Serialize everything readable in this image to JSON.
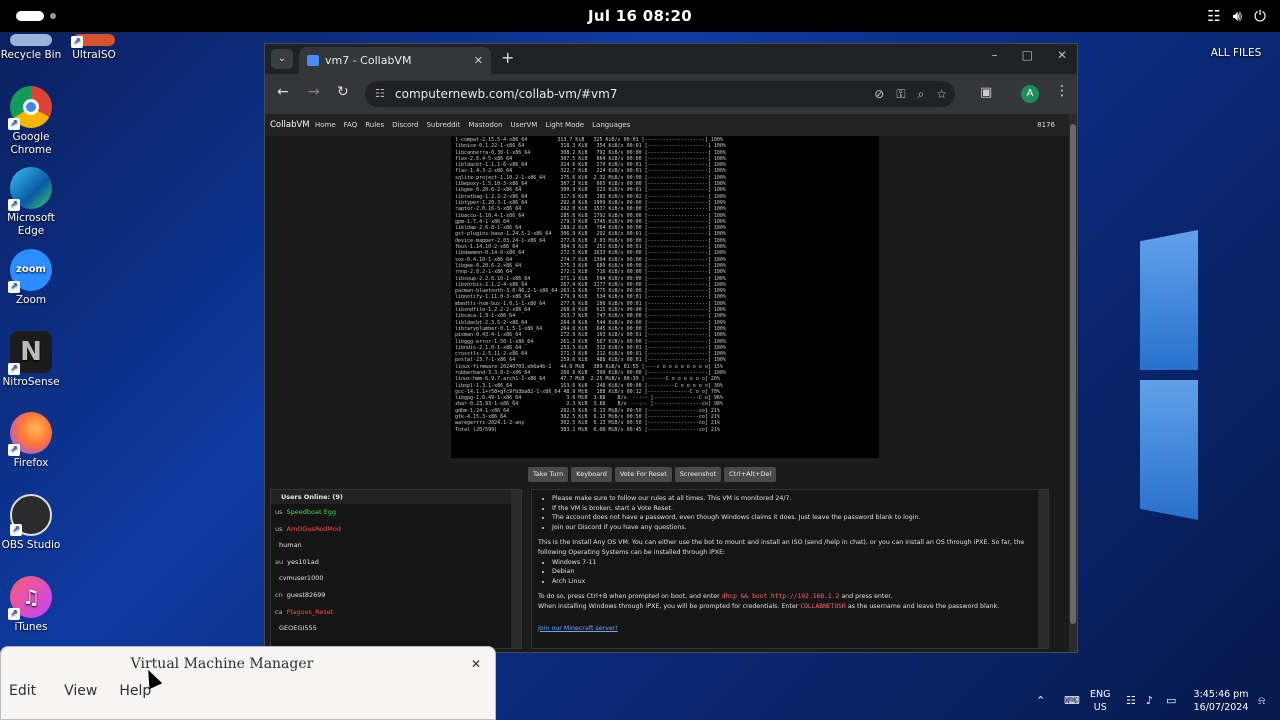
{
  "topbar": {
    "datetime": "Jul 16  08:20"
  },
  "desktop": {
    "icons": [
      {
        "label": "Recycle Bin",
        "icon": "recycle-bin-icon"
      },
      {
        "label": "UltraISO",
        "icon": "ultraiso-icon"
      },
      {
        "label": "Google Chrome",
        "icon": "chrome-icon"
      },
      {
        "label": "Microsoft Edge",
        "icon": "edge-icon"
      },
      {
        "label": "Zoom",
        "icon": "zoom-icon"
      },
      {
        "label": "NitroSense",
        "icon": "nitrosense-icon"
      },
      {
        "label": "Firefox",
        "icon": "firefox-icon"
      },
      {
        "label": "OBS Studio",
        "icon": "obs-icon"
      },
      {
        "label": "iTunes",
        "icon": "itunes-icon"
      }
    ],
    "all_files": "ALL FILES"
  },
  "browser": {
    "tab_title": "vm7 - CollabVM",
    "url": "computernewb.com/collab-vm/#vm7",
    "profile_initial": "A",
    "site_nav": {
      "brand": "CollabVM",
      "items": [
        "Home",
        "FAQ",
        "Rules",
        "Discord",
        "Subreddit",
        "Mastodon",
        "UserVM",
        "Light Mode",
        "Languages"
      ],
      "user_count": "8176"
    },
    "vm_console": "l-compat-2.15.5-4-x86_64          313.7 KiB   325 KiB/s 00:01 [--------------------] 100%\nlibnice-0.1.22-1-x86_64            318.3 KiB   354 KiB/s 00:01 [--------------------] 100%\nlibcanberra-0.30-1-x86_64          308.2 KiB   792 KiB/s 00:00 [--------------------] 100%\nflex-2.6.4-5-x86_64                307.5 KiB   664 KiB/s 00:00 [--------------------] 100%\nlibldacbt-1.1.1-6-x86_64           314.6 KiB   270 KiB/s 00:01 [--------------------] 100%\nflac-1.4.3-2-x86_64                322.7 KiB   224 KiB/s 00:01 [--------------------] 100%\nsqlite-project-1.10.2-1-x86_64     275.6 KiB  2.32 MiB/s 00:00 [--------------------] 100%\nlibepoxy-1.5.10-3-x86_64           307.3 KiB   665 KiB/s 00:00 [--------------------] 100%\nlibgee-0.20.6-2-x86_64             300.9 KiB   323 KiB/s 00:01 [--------------------] 100%\nlibratbag-1.2.2-2-x86_64           317.6 KiB   183 KiB/s 00:02 [--------------------] 100%\nlibtyper-1.20.3-1-x86_64           292.0 KiB  1909 KiB/s 00:00 [--------------------] 100%\nraptor-2.0.16-5-x86_64             292.0 KiB  1537 KiB/s 00:00 [--------------------] 100%\nlibaccu-1.10.4-1-x86_64            285.6 KiB  1792 KiB/s 00:00 [--------------------] 100%\ngpm-1.7.4-1-x86_64                 279.3 KiB  1745 KiB/s 00:00 [--------------------] 100%\nlibldap-2.6.8-1-x86_64             289.2 KiB   764 KiB/s 00:00 [--------------------] 100%\ngst-plugins-base-1.24.5-2-x86_64   306.9 KiB   292 KiB/s 00:01 [--------------------] 100%\ndevice-mapper-2.03.24-1-x86_64     277.6 KiB  2.03 MiB/s 00:00 [--------------------] 100%\nfbus-1.14.10-2-x86_64              304.9 KiB   251 KiB/s 00:01 [--------------------] 100%\nlibdaemon-0.14-6-x86_64            272.5 KiB  1633 KiB/s 00:00 [--------------------] 100%\nsox-0.4.10-1-x86_64                274.7 KiB  1304 KiB/s 00:00 [--------------------] 100%\nlibgee-0.20.6-2-x86_64             275.3 KiB   689 KiB/s 00:00 [--------------------] 100%\nrnnp-2.0.2-1-x86_64                272.1 KiB   716 KiB/s 00:00 [--------------------] 100%\nlibsoup-2.2.6.10-1-x86_64          271.1 KiB   594 KiB/s 00:00 [--------------------] 100%\nlibvorbis-2.1.2-4-x86_64           267.4 KiB  1177 KiB/s 00:00 [--------------------] 100%\npacman-bluetooth-3.0.46.2-1-x86_64 263.1 KiB   775 KiB/s 00:00 [--------------------] 100%\nlibnotify-1.11.0-3-x86_64          279.9 KiB   534 KiB/s 00:01 [--------------------] 100%\nmbedtls-hsm-bus-1.0.1-1-x86_64     277.6 KiB   286 KiB/s 00:01 [--------------------] 100%\nlibsndfile-1.2.2-2-x86_64          268.6 KiB   615 KiB/s 00:00 [--------------------] 100%\nlibcaca-1.9-1-x86_64               263.7 KiB   747 KiB/s 00:00 [--------------------] 100%\nlibldacbt-2.3.5-2-x86_64           264.0 KiB   544 KiB/s 00:00 [--------------------] 100%\nlibraryplumber-0.1.5-1-x86_64      264.0 KiB   645 KiB/s 00:00 [--------------------] 100%\npixman-0.43.4-1-x86_64             272.9 KiB   103 KiB/s 00:01 [--------------------] 100%\nlibggg-error-1.50-1-x86_64         261.3 KiB   567 KiB/s 00:00 [--------------------] 100%\nlibndis-2.1.0-1-x86_64             253.5 KiB   312 KiB/s 00:01 [--------------------] 100%\ncrosstls-2.5.11-2-x86_64           271.3 KiB   212 KiB/s 00:01 [--------------------] 100%\npostal-23.7-1-x86_64               259.6 KiB   488 KiB/s 00:01 [--------------------] 100%\nlinux-firmware-20240703.eb6a4b-1   44.0 MiB   389 KiB/s 01:55 [----c o o o o o o o o] 15%\nrubberband-3.3.0-2-x86_64          260.6 KiB   390 KiB/s 00:00 [--------------------] 100%\nlinux-hmm-6.9.7.arch1-1-x86_64     47.7 MiB  2.25 MiB/s 00:39 [-------C o o o o o o] 20%\nlibxpl-1.3.1-x86_64                153.6 KiB   248 KiB/s 00:00 [---------C o o o o o] 30%\ngcc-14.1.1+r58+gfc9fb3ba82-1-x86_64 48.9 MiB   188 KiB/s 00:12 [--------------C o o] 70%\nlibgpg-1.6.49-1-x86_64               3.6 MiB  3.88    B/s  --:-- [---------------C o] 96%\nzbar-0.23.93-1-x86_64                2.3 KiB  3.88    B/s  --:-- [----------------co] 98%\ngdbm-1.24-1-x86_64                 202.5 KiB  6.13 MiB/s 00:50 [-----------------co] 21%\ngtk-4.15.3-x86_64                  302.5 KiB  6.13 MiB/s 00:50 [-----------------co] 21%\nwaregerrrs-2024.1-2-any            302.5 KiB  6.13 MiB/s 00:50 [-----------------co] 21%\nTotal (20/599)                     383.1 MiB  6.00 MiB/s 00:45 [-----------------co] 21%",
    "vm_buttons": [
      "Take Turn",
      "Keyboard",
      "Vote For Reset",
      "Screenshot",
      "Ctrl+Alt+Del"
    ],
    "users_header": "Users Online: (9)",
    "users": [
      {
        "flag": "us",
        "name": "Speedboat Egg",
        "color": "#4cd84c"
      },
      {
        "flag": "us",
        "name": "AmOGusRedMod",
        "color": "#ff4a4a"
      },
      {
        "flag": "",
        "name": "human",
        "color": "#e6e6e6"
      },
      {
        "flag": "au",
        "name": "yes101ad",
        "color": "#e6e6e6"
      },
      {
        "flag": "",
        "name": "cvmuser1000",
        "color": "#e6e6e6"
      },
      {
        "flag": "cn",
        "name": "guest82699",
        "color": "#e6e6e6"
      },
      {
        "flag": "ca",
        "name": "Plagues_Reset",
        "color": "#ff4a4a"
      },
      {
        "flag": "",
        "name": "GEOEGI555",
        "color": "#e6e6e6"
      }
    ],
    "chat": {
      "bullets_top": [
        "Please make sure to follow our rules at all times. This VM is monitored 24/7.",
        "If the VM is broken, start a Vote Reset.",
        "The account does not have a password, even though Windows claims it does. Just leave the password blank to login.",
        "Join our Discord if you have any questions."
      ],
      "intro": "This is the Install Any OS VM. You can either use the bot to mount and install an ISO (send /help in chat), or you can install an OS through iPXE. So far, the following Operating Systems can be installed through iPXE:",
      "os_list": [
        "Windows 7-11",
        "Debian",
        "Arch Linux"
      ],
      "line_pre": "To do so, press Ctrl+B when prompted on boot, and enter",
      "cmd": "dhcp && boot http://192.168.1.2",
      "line_post": "and press enter.",
      "cred_pre": "When installing Windows through iPXE, you will be prompted for credentials. Enter",
      "cred_code": "COLLABNETUSR",
      "cred_post": "as the username and leave the password blank.",
      "link": "Join our Minecraft server!"
    }
  },
  "vmm": {
    "title": "Virtual Machine Manager",
    "menu": [
      "Edit",
      "View",
      "Help"
    ]
  },
  "taskbar": {
    "lang_line1": "ENG",
    "lang_line2": "US",
    "time": "3:45:46 pm",
    "date": "16/07/2024"
  }
}
